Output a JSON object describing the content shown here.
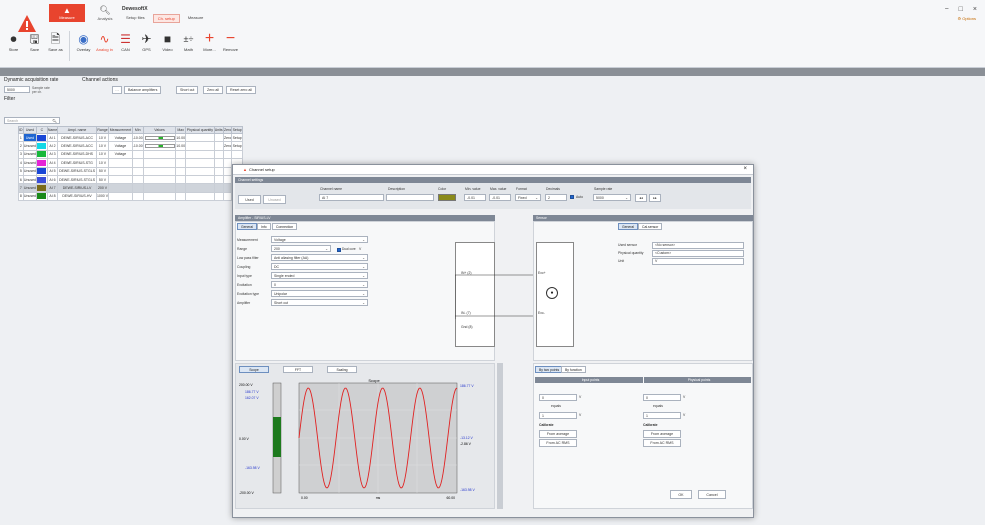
{
  "app": {
    "title": "DewesoftX",
    "options": "Options",
    "win": {
      "min": "−",
      "max": "□",
      "close": "×"
    }
  },
  "mode_tabs": [
    {
      "label": "Measure"
    },
    {
      "label": "Analysis"
    }
  ],
  "sub_tabs": [
    {
      "label": "Setup files"
    },
    {
      "label": "Ch. setup"
    },
    {
      "label": "Measure"
    }
  ],
  "toolbar": [
    {
      "label": "Store",
      "icon": "record-icon"
    },
    {
      "label": "Save",
      "icon": "save-icon"
    },
    {
      "label": "Save as",
      "icon": "save-as-icon"
    },
    {
      "label": "Overlay",
      "icon": "overlay-icon"
    },
    {
      "label": "Analog in",
      "icon": "analog-in-icon"
    },
    {
      "label": "CAN",
      "icon": "can-icon"
    },
    {
      "label": "GPS",
      "icon": "gps-icon"
    },
    {
      "label": "Video",
      "icon": "video-icon"
    },
    {
      "label": "Math",
      "icon": "math-icon"
    },
    {
      "label": "More...",
      "icon": "plus-icon"
    },
    {
      "label": "Remove",
      "icon": "minus-icon"
    }
  ],
  "panel": {
    "acq_label": "Dynamic acquisition rate",
    "rate": "5000",
    "rate_unit": "Sample rate per ch.",
    "channel_label": "Channel actions",
    "balance": "Balance amplifiers",
    "short": "Short cut",
    "zero": "Zero all",
    "reset": "Reset zero all",
    "filter_label": "Filter",
    "search": "Search"
  },
  "table": {
    "headers": [
      "ID",
      "Used",
      "C",
      "Name",
      "Ampl. name",
      "Range",
      "Measurement",
      "Min",
      "Values",
      "Max",
      "Physical quantity",
      "Units",
      "Zero",
      "Setup"
    ],
    "rows": [
      {
        "id": "1",
        "used": "Used",
        "color": "#1a47d6",
        "name": "AI 1",
        "ampl": "DEWE-SIRIUS-ACC",
        "range": "10 V",
        "meas": "Voltage",
        "min": "-10.00",
        "max": "10.00",
        "zero": "Zero",
        "setup": "Setup"
      },
      {
        "id": "2",
        "used": "Unused",
        "color": "#12d8e6",
        "name": "AI 2",
        "ampl": "DEWE-SIRIUS-ACC",
        "range": "10 V",
        "meas": "Voltage",
        "min": "-10.00",
        "max": "10.00",
        "zero": "Zero",
        "setup": "Setup"
      },
      {
        "id": "3",
        "used": "Unused",
        "color": "#17b83a",
        "name": "AI 3",
        "ampl": "DEWE-SIRIUS-DHS",
        "range": "10 V",
        "meas": "Voltage",
        "min": "",
        "max": "",
        "zero": "",
        "setup": ""
      },
      {
        "id": "4",
        "used": "Unused",
        "color": "#e524d6",
        "name": "AI 4",
        "ampl": "DEWE-SIRIUS-STG",
        "range": "10 V",
        "meas": "",
        "min": "",
        "max": "",
        "zero": "",
        "setup": ""
      },
      {
        "id": "5",
        "used": "Unused",
        "color": "#1a47d6",
        "name": "AI 5",
        "ampl": "DEWE-SIRIUS-STGLS",
        "range": "50 V",
        "meas": "",
        "min": "",
        "max": "",
        "zero": "",
        "setup": ""
      },
      {
        "id": "6",
        "used": "Unused",
        "color": "#3a4dd9",
        "name": "AI 6",
        "ampl": "DEWE-SIRIUS-STGLS",
        "range": "50 V",
        "meas": "",
        "min": "",
        "max": "",
        "zero": "",
        "setup": ""
      },
      {
        "id": "7",
        "used": "Unused",
        "color": "#7a6a18",
        "name": "AI 7",
        "ampl": "DEWE-SIRIUS-LV",
        "range": "200 V",
        "meas": "",
        "min": "",
        "max": "",
        "zero": "",
        "setup": ""
      },
      {
        "id": "8",
        "used": "Unused",
        "color": "#1a8a1a",
        "name": "AI 8",
        "ampl": "DEWE-SIRIUS-HV",
        "range": "1000 V",
        "meas": "",
        "min": "",
        "max": "",
        "zero": "",
        "setup": ""
      }
    ]
  },
  "dialog": {
    "title": "Channel setup",
    "close": "×",
    "settings_label": "Channel settings",
    "used_btn": "Used",
    "unused_btn": "Unused",
    "channel_name_label": "Channel name",
    "channel_name": "AI 7",
    "description_label": "Description",
    "color_label": "Color",
    "color": "#8a8a1a",
    "min_label": "Min. value",
    "min": "-0.01",
    "max_label": "Max. value",
    "max": "-0.01",
    "format_label": "Format",
    "format": "Fixed",
    "decimals_label": "Decimals",
    "decimals": "2",
    "auto_label": "Auto",
    "sample_rate_label": "Sample rate",
    "sample_rate": "5000",
    "amp_section": "Amplifier - SIRIUS-LV",
    "amp_tabs": [
      "General",
      "Info",
      "Connection"
    ],
    "fields": [
      {
        "label": "Measurement",
        "value": "Voltage"
      },
      {
        "label": "Range",
        "value": "200"
      },
      {
        "label": "Low pass filter",
        "value": "Anti aliasing filter (AA)"
      },
      {
        "label": "Coupling",
        "value": "DC"
      },
      {
        "label": "Input type",
        "value": "Single ended"
      },
      {
        "label": "Excitation",
        "value": "0"
      },
      {
        "label": "Excitation type",
        "value": "Unipolar"
      },
      {
        "label": "Amplifier",
        "value": "Short cut"
      }
    ],
    "range_unit": "V",
    "dual_core_label": "Dual core",
    "conn": {
      "in_plus": "IN+ (2)",
      "in_minus": "IN- (7)",
      "gnd": "Gnd (8)",
      "exc_plus": "Exc+",
      "exc_minus": "Exc-"
    },
    "sensor_section": "Sensor",
    "sensor_tabs": [
      "General",
      "Cal.sensor"
    ],
    "sensor_fields": [
      {
        "label": "Used sensor",
        "value": "<No sensor>"
      },
      {
        "label": "Physical quantity",
        "value": "<Custom>"
      },
      {
        "label": "Unit",
        "value": "V"
      }
    ],
    "scale_tabs": [
      "By two points",
      "By function"
    ],
    "scale_headers": [
      "Input points",
      "Physical points"
    ],
    "scale_rows": [
      {
        "in": "0",
        "in_unit": "V",
        "out": "0",
        "out_unit": "V"
      },
      {
        "in": "1",
        "in_unit": "V",
        "out": "1",
        "out_unit": "V"
      }
    ],
    "equals_label": "equals",
    "calibrate_label": "Calibrate",
    "from_avg": "From average",
    "from_rms": "From AC RMS",
    "preview_tabs": [
      "Scope",
      "FFT",
      "Scaling"
    ],
    "scope": {
      "title": "Scope",
      "y_top": "200.00 V",
      "y_bot": "-200.00 V",
      "y_mid": "0.00 V",
      "l1": "186.77 V",
      "l2": "162.07 V",
      "l3": "-163.98 V",
      "r1": "186.77 V",
      "r2": "-13.12 V",
      "r3": "-2.86 V",
      "r4": "-163.98 V",
      "x0": "0.00",
      "x1": "ms",
      "x2": "60.00"
    },
    "ok": "OK",
    "cancel": "Cancel"
  }
}
